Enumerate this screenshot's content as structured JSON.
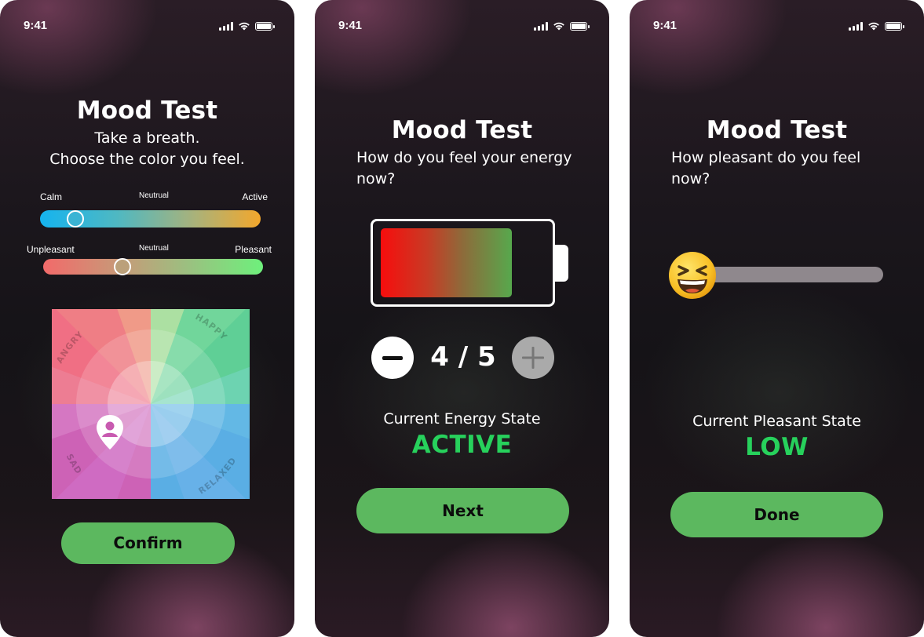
{
  "colors": {
    "accent_green": "#5cb85f",
    "state_green": "#27d15c"
  },
  "screens": [
    {
      "status_time": "9:41",
      "title": "Mood Test",
      "subtitle_line1": "Take a breath.",
      "subtitle_line2": "Choose the color you feel.",
      "energy_slider": {
        "left": "Calm",
        "middle": "Neutrual",
        "right": "Active",
        "value": 0.13
      },
      "pleasant_slider": {
        "left": "Unpleasant",
        "middle": "Neutrual",
        "right": "Pleasant",
        "value": 0.35
      },
      "wheel": {
        "angry": "ANGRY",
        "happy": "HAPPY",
        "sad": "SAD",
        "relaxed": "RELAXED"
      },
      "confirm_label": "Confirm"
    },
    {
      "status_time": "9:41",
      "title": "Mood Test",
      "subtitle_line1": "How do you feel your energy",
      "subtitle_line2": "now?",
      "energy_level": 4,
      "counter": "4 / 5",
      "state_label": "Current Energy State",
      "state_value": "ACTIVE",
      "next_label": "Next"
    },
    {
      "status_time": "9:41",
      "title": "Mood Test",
      "subtitle_line1": "How pleasant do you feel",
      "subtitle_line2": "now?",
      "pleasant_value": 0.0,
      "emoji_icon": "laughing-face-icon",
      "state_label": "Current Pleasant State",
      "state_value": "LOW",
      "done_label": "Done"
    }
  ]
}
